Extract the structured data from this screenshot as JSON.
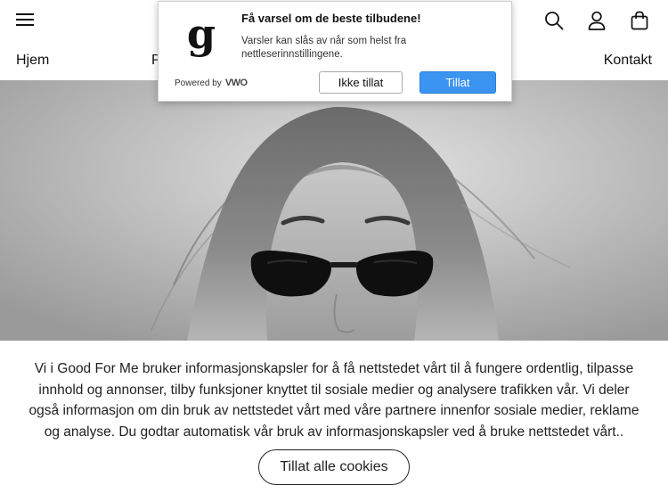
{
  "header": {
    "menu_icon": "hamburger-menu-icon",
    "search_icon": "search-icon",
    "account_icon": "user-icon",
    "cart_icon": "shopping-bag-icon"
  },
  "nav": {
    "items": [
      "Hjem",
      "P",
      "Kontakt"
    ]
  },
  "hero": {
    "image": "black-and-white-portrait-woman-sunglasses"
  },
  "push_prompt": {
    "logo_letter": "g",
    "title": "Få varsel om de beste tilbudene!",
    "description": "Varsler kan slås av når som helst fra nettleserinnstillingene.",
    "powered_by": "Powered by",
    "powered_brand": "VWO",
    "deny_label": "Ikke tillat",
    "allow_label": "Tillat",
    "allow_color": "#3b94f0"
  },
  "cookie_banner": {
    "text": "Vi i Good For Me bruker informasjonskapsler for å få nettstedet vårt til å fungere ordentlig, tilpasse innhold og annonser, tilby funksjoner knyttet til sosiale medier og analysere trafikken vår. Vi deler også informasjon om din bruk av nettstedet vårt med våre partnere innenfor sosiale medier, reklame og analyse. Du godtar automatisk vår bruk av informasjonskapsler ved å bruke nettstedet vårt..",
    "accept_label": "Tillat alle cookies"
  }
}
